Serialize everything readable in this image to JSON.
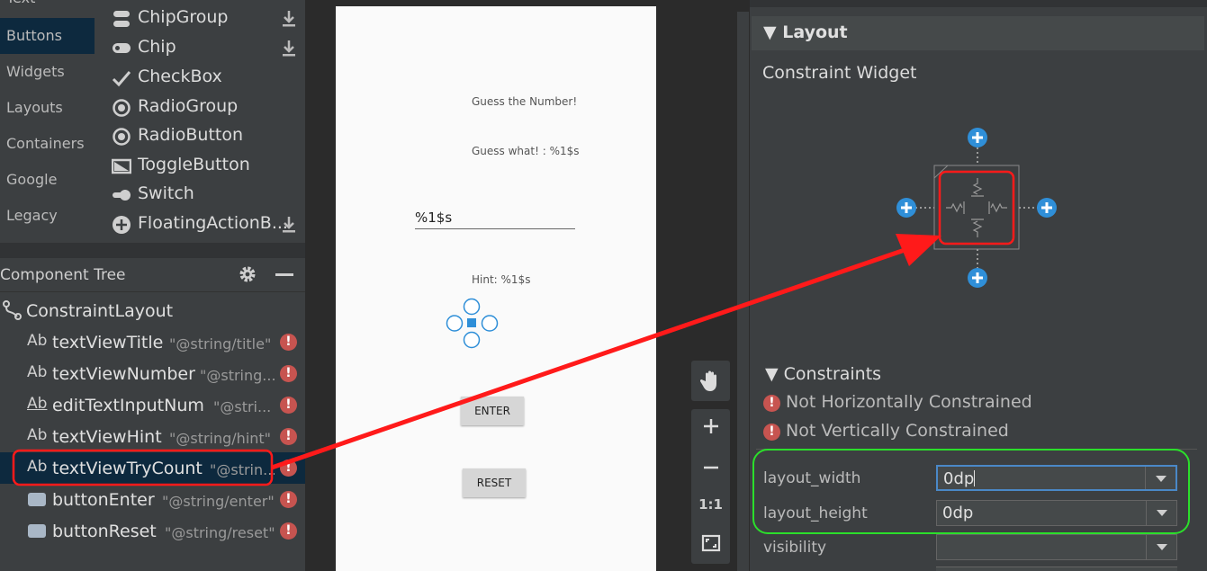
{
  "palette": {
    "categories": [
      {
        "label": "Text"
      },
      {
        "label": "Buttons"
      },
      {
        "label": "Widgets"
      },
      {
        "label": "Layouts"
      },
      {
        "label": "Containers"
      },
      {
        "label": "Google"
      },
      {
        "label": "Legacy"
      }
    ],
    "items": [
      {
        "label": "ChipGroup",
        "icon": "chip-group-icon",
        "download": true
      },
      {
        "label": "Chip",
        "icon": "chip-icon",
        "download": true
      },
      {
        "label": "CheckBox",
        "icon": "checkbox-icon",
        "download": false
      },
      {
        "label": "RadioGroup",
        "icon": "radio-group-icon",
        "download": false
      },
      {
        "label": "RadioButton",
        "icon": "radio-button-icon",
        "download": false
      },
      {
        "label": "ToggleButton",
        "icon": "toggle-button-icon",
        "download": false
      },
      {
        "label": "Switch",
        "icon": "switch-icon",
        "download": false
      },
      {
        "label": "FloatingActionB...",
        "icon": "fab-icon",
        "download": true
      }
    ]
  },
  "tree": {
    "title": "Component Tree",
    "root": "ConstraintLayout",
    "rows": [
      {
        "icon": "Ab",
        "name": "textViewTitle",
        "value": "\"@string/title\""
      },
      {
        "icon": "Ab",
        "name": "textViewNumber",
        "value": "\"@string..."
      },
      {
        "icon": "Ab",
        "name": "editTextInputNum",
        "value": "\"@stri..."
      },
      {
        "icon": "Ab",
        "name": "textViewHint",
        "value": "\"@string/hint\""
      },
      {
        "icon": "Ab",
        "name": "textViewTryCount",
        "value": "\"@strin..."
      },
      {
        "icon": "button",
        "name": "buttonEnter",
        "value": "\"@string/enter\""
      },
      {
        "icon": "button",
        "name": "buttonReset",
        "value": "\"@string/reset\""
      }
    ]
  },
  "phone": {
    "title": "Guess the Number!",
    "number": "Guess what! : %1$s",
    "input": "%1$s",
    "hint": "Hint: %1$s",
    "enter": "ENTER",
    "reset": "RESET"
  },
  "toolbar": {
    "ratio": "1:1"
  },
  "attributes": {
    "section": "Layout",
    "widget_title": "Constraint Widget",
    "constraints_title": "Constraints",
    "warnings": [
      "Not Horizontally Constrained",
      "Not Vertically Constrained"
    ],
    "props": [
      {
        "label": "layout_width",
        "value": "0dp"
      },
      {
        "label": "layout_height",
        "value": "0dp"
      },
      {
        "label": "visibility",
        "value": ""
      }
    ]
  },
  "colors": {
    "accent_red": "#ff1a1a",
    "highlight_green": "#2bdf2b",
    "selection_blue": "#0d293e",
    "error_red": "#c75450",
    "handle_blue": "#2f8fd8"
  }
}
